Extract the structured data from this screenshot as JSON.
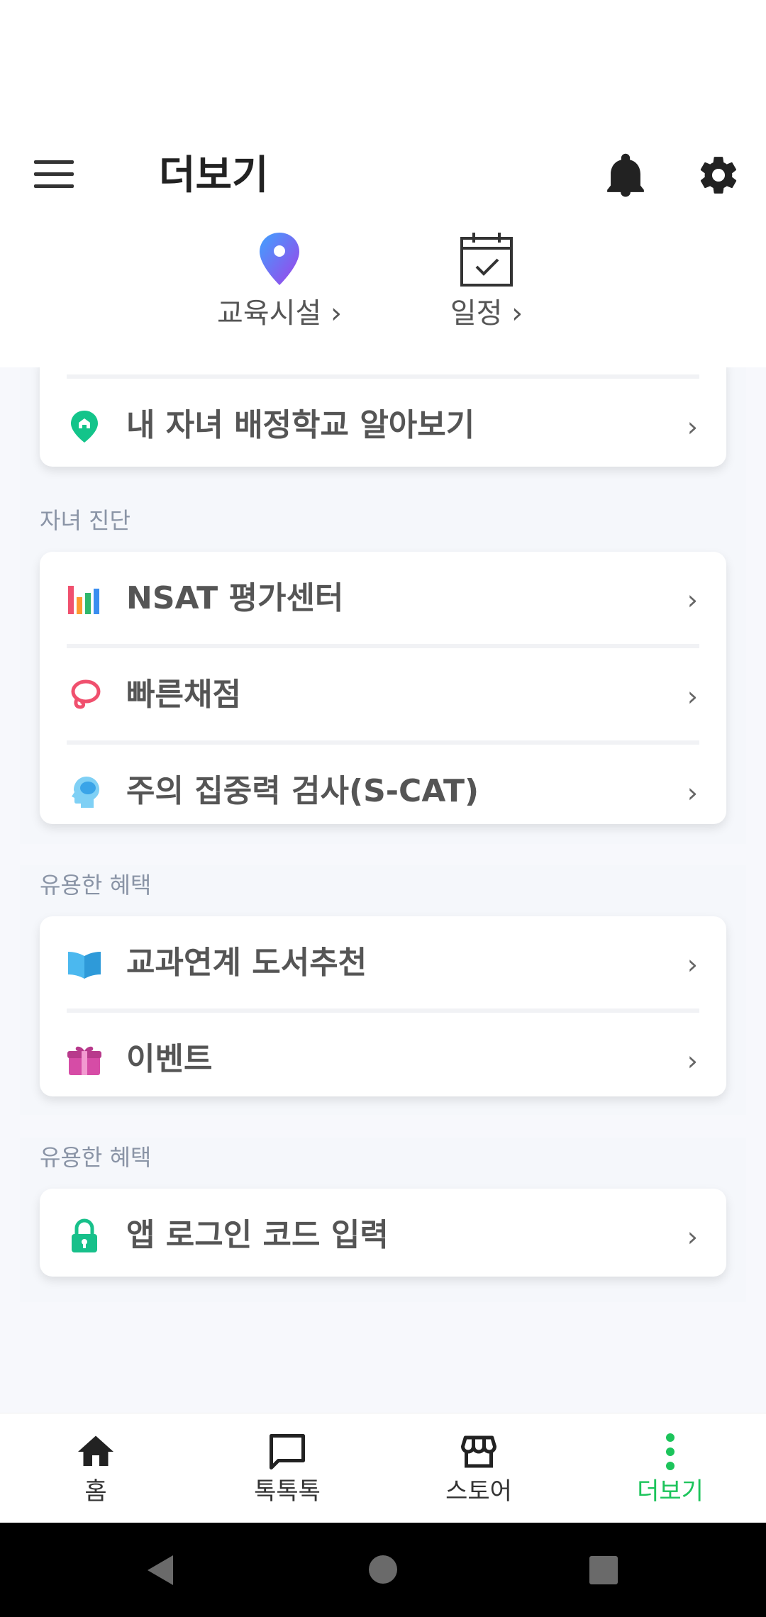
{
  "header": {
    "title": "더보기",
    "menu_icon": "hamburger-icon",
    "bell_icon": "bell-icon",
    "gear_icon": "gear-icon"
  },
  "quick_links": [
    {
      "label": "교육시설 ›",
      "icon": "location-pin-icon",
      "color": "#7a5cf0"
    },
    {
      "label": "일정 ›",
      "icon": "calendar-check-icon"
    }
  ],
  "sections": [
    {
      "items": [
        {
          "label": "내 자녀 배정학교 알아보기",
          "icon": "school-pin-icon"
        }
      ]
    },
    {
      "title": "자녀 진단",
      "items": [
        {
          "label": "NSAT 평가센터",
          "icon": "bar-chart-icon"
        },
        {
          "label": "빠른채점",
          "icon": "lasso-icon"
        },
        {
          "label": "주의 집중력 검사(S-CAT)",
          "icon": "brain-head-icon"
        }
      ]
    },
    {
      "title": "유용한 혜택",
      "items": [
        {
          "label": "교과연계 도서추천",
          "icon": "book-icon"
        },
        {
          "label": "이벤트",
          "icon": "gift-icon"
        }
      ]
    },
    {
      "title": "유용한 혜택",
      "items": [
        {
          "label": "앱 로그인 코드 입력",
          "icon": "lock-icon"
        }
      ]
    }
  ],
  "chevron": "›",
  "tabs": [
    {
      "label": "홈",
      "icon": "home-icon"
    },
    {
      "label": "톡톡톡",
      "icon": "chat-icon"
    },
    {
      "label": "스토어",
      "icon": "store-icon"
    },
    {
      "label": "더보기",
      "icon": "more-vertical-icon",
      "active": true
    }
  ],
  "colors": {
    "accent": "#1cc45b",
    "section_title": "#8a94a6"
  }
}
